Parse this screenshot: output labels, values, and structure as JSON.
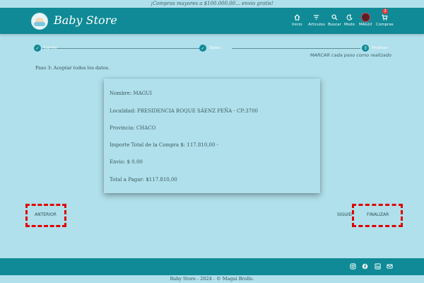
{
  "promo": "¡Compras mayores a $100.000,00... envio gratis!",
  "brand": "Baby Store",
  "nav": {
    "home": "Inicio",
    "articles": "Articulos",
    "search": "Buscar",
    "mode": "Modo",
    "user": "MAGUI",
    "cart": "Compras",
    "cart_count": "3"
  },
  "steps": {
    "items": [
      {
        "label": "Carrito",
        "marker": "✓"
      },
      {
        "label": "Datos",
        "marker": "✓"
      },
      {
        "label": "Finalizar",
        "marker": "3"
      }
    ],
    "note": "MARCAR cada paso como realizado"
  },
  "instructions": "Paso 3: Aceptar todos los datos.",
  "summary": {
    "name": "Nombre: MAGUI",
    "locality": "Localidad: PRESIDENCIA ROQUE SÁENZ PEÑA - CP:3700",
    "province": "Provincia: CHACO",
    "total_purchase": "Importe Total de la Compra $: 117.810,00 -",
    "shipping": "Envio: $ 0.00",
    "total_to_pay": "Total a Pagar: $117.810,00"
  },
  "buttons": {
    "previous": "ANTERIOR",
    "next": "SIGUIENTE",
    "finish": "FINALIZAR"
  },
  "footer": {
    "copyright": "Baby Store - 2024 - © Magui Brollo."
  },
  "colors": {
    "primary": "#0f8a96",
    "background": "#b0e0eb",
    "highlight": "#e00000"
  }
}
